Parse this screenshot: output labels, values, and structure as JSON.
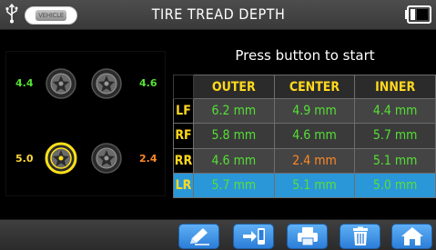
{
  "header": {
    "title": "TIRE TREAD DEPTH",
    "usb_icon": "usb-icon",
    "vehicle_icon": "vehicle-icon",
    "vehicle_label": "VEHICLE",
    "battery_icon": "battery-icon"
  },
  "tires": {
    "lf": {
      "value": "4.4",
      "status": "ok"
    },
    "rf": {
      "value": "4.6",
      "status": "ok"
    },
    "lr": {
      "value": "5.0",
      "status": "warn",
      "selected": true
    },
    "rr": {
      "value": "2.4",
      "status": "bad"
    }
  },
  "prompt": "Press button to start",
  "table": {
    "headers": [
      "OUTER",
      "CENTER",
      "INNER"
    ],
    "rows": [
      {
        "pos": "LF",
        "outer": "6.2 mm",
        "center": "4.9 mm",
        "inner": "4.4 mm"
      },
      {
        "pos": "RF",
        "outer": "5.8 mm",
        "center": "4.6 mm",
        "inner": "5.7 mm"
      },
      {
        "pos": "RR",
        "outer": "4.6 mm",
        "center": "2.4 mm",
        "inner": "5.1 mm"
      },
      {
        "pos": "LR",
        "outer": "5.7 mm",
        "center": "5.1 mm",
        "inner": "5.0 mm"
      }
    ]
  },
  "toolbar": {
    "buttons": [
      "edit-icon",
      "send-to-device-icon",
      "print-icon",
      "trash-icon",
      "home-icon"
    ]
  },
  "colors": {
    "ok": "#55e035",
    "warn": "#ffd83a",
    "bad": "#ff8a25",
    "header_text": "#ffd91e",
    "selected_row": "#2a98d8",
    "button_blue": "#2b7dd8"
  }
}
